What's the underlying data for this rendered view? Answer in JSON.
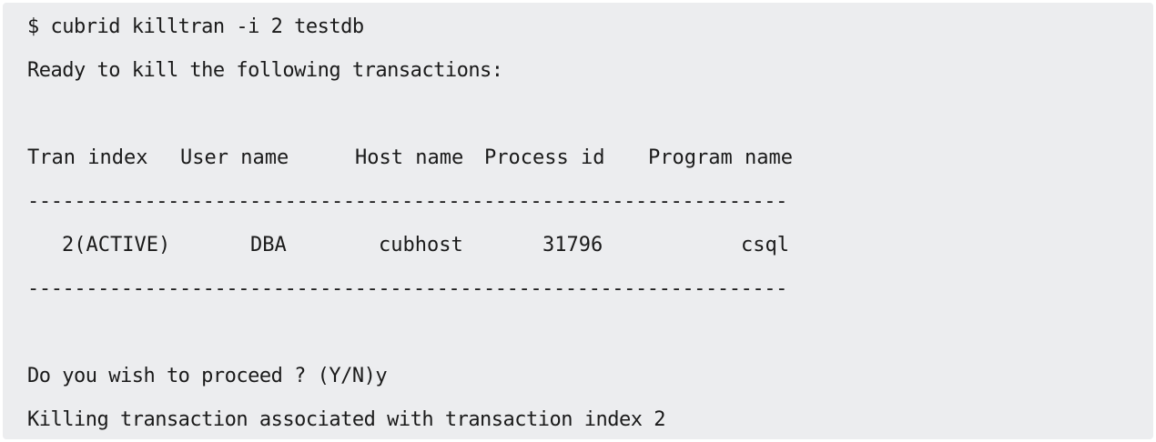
{
  "terminal": {
    "command": "$ cubrid killtran -i 2 testdb",
    "ready_message": "Ready to kill the following transactions:",
    "columns": [
      "Tran index",
      "User name",
      "Host name",
      "Process id",
      "Program name"
    ],
    "separator": "----------------------------------------------------------------------",
    "rows": [
      [
        "2(ACTIVE)",
        "DBA",
        "cubhost",
        "31796",
        "csql"
      ]
    ],
    "prompt": "Do you wish to proceed ? (Y/N)y",
    "result": "Killing transaction associated with transaction index 2"
  }
}
